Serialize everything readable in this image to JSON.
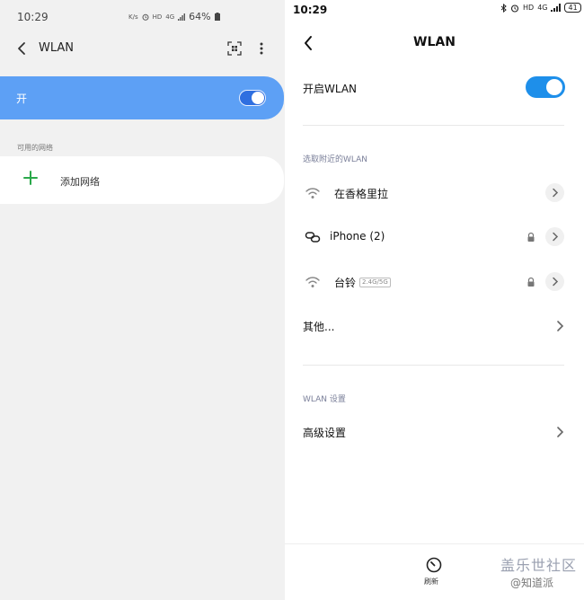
{
  "left": {
    "status": {
      "time": "10:29",
      "net_speed": "K/s",
      "hd": "HD",
      "net_type": "4G",
      "battery": "64%"
    },
    "header": {
      "title": "WLAN"
    },
    "toggle": {
      "label": "开",
      "on": true
    },
    "section_title": "可用的网络",
    "add_network": {
      "label": "添加网络"
    },
    "accent_color": "#5da0f5"
  },
  "right": {
    "status": {
      "time": "10:29",
      "hd": "HD",
      "net_type": "4G",
      "battery": "41"
    },
    "header": {
      "title": "WLAN"
    },
    "toggle": {
      "label": "开启WLAN",
      "on": true
    },
    "nearby_section": "选取附近的WLAN",
    "networks": [
      {
        "name": "在香格里拉",
        "tag": "",
        "locked": false,
        "icon": "wifi-icon"
      },
      {
        "name": "iPhone (2)",
        "tag": "",
        "locked": true,
        "icon": "hotspot-link-icon"
      },
      {
        "name": "台铃",
        "tag": "2.4G/5G",
        "locked": true,
        "icon": "wifi-icon"
      }
    ],
    "other": "其他...",
    "settings_section": "WLAN 设置",
    "advanced": "高级设置",
    "refresh": "刷新",
    "accent_color": "#1e8fea"
  },
  "watermark": {
    "main": "盖乐世社区",
    "sub": "@知道派"
  }
}
